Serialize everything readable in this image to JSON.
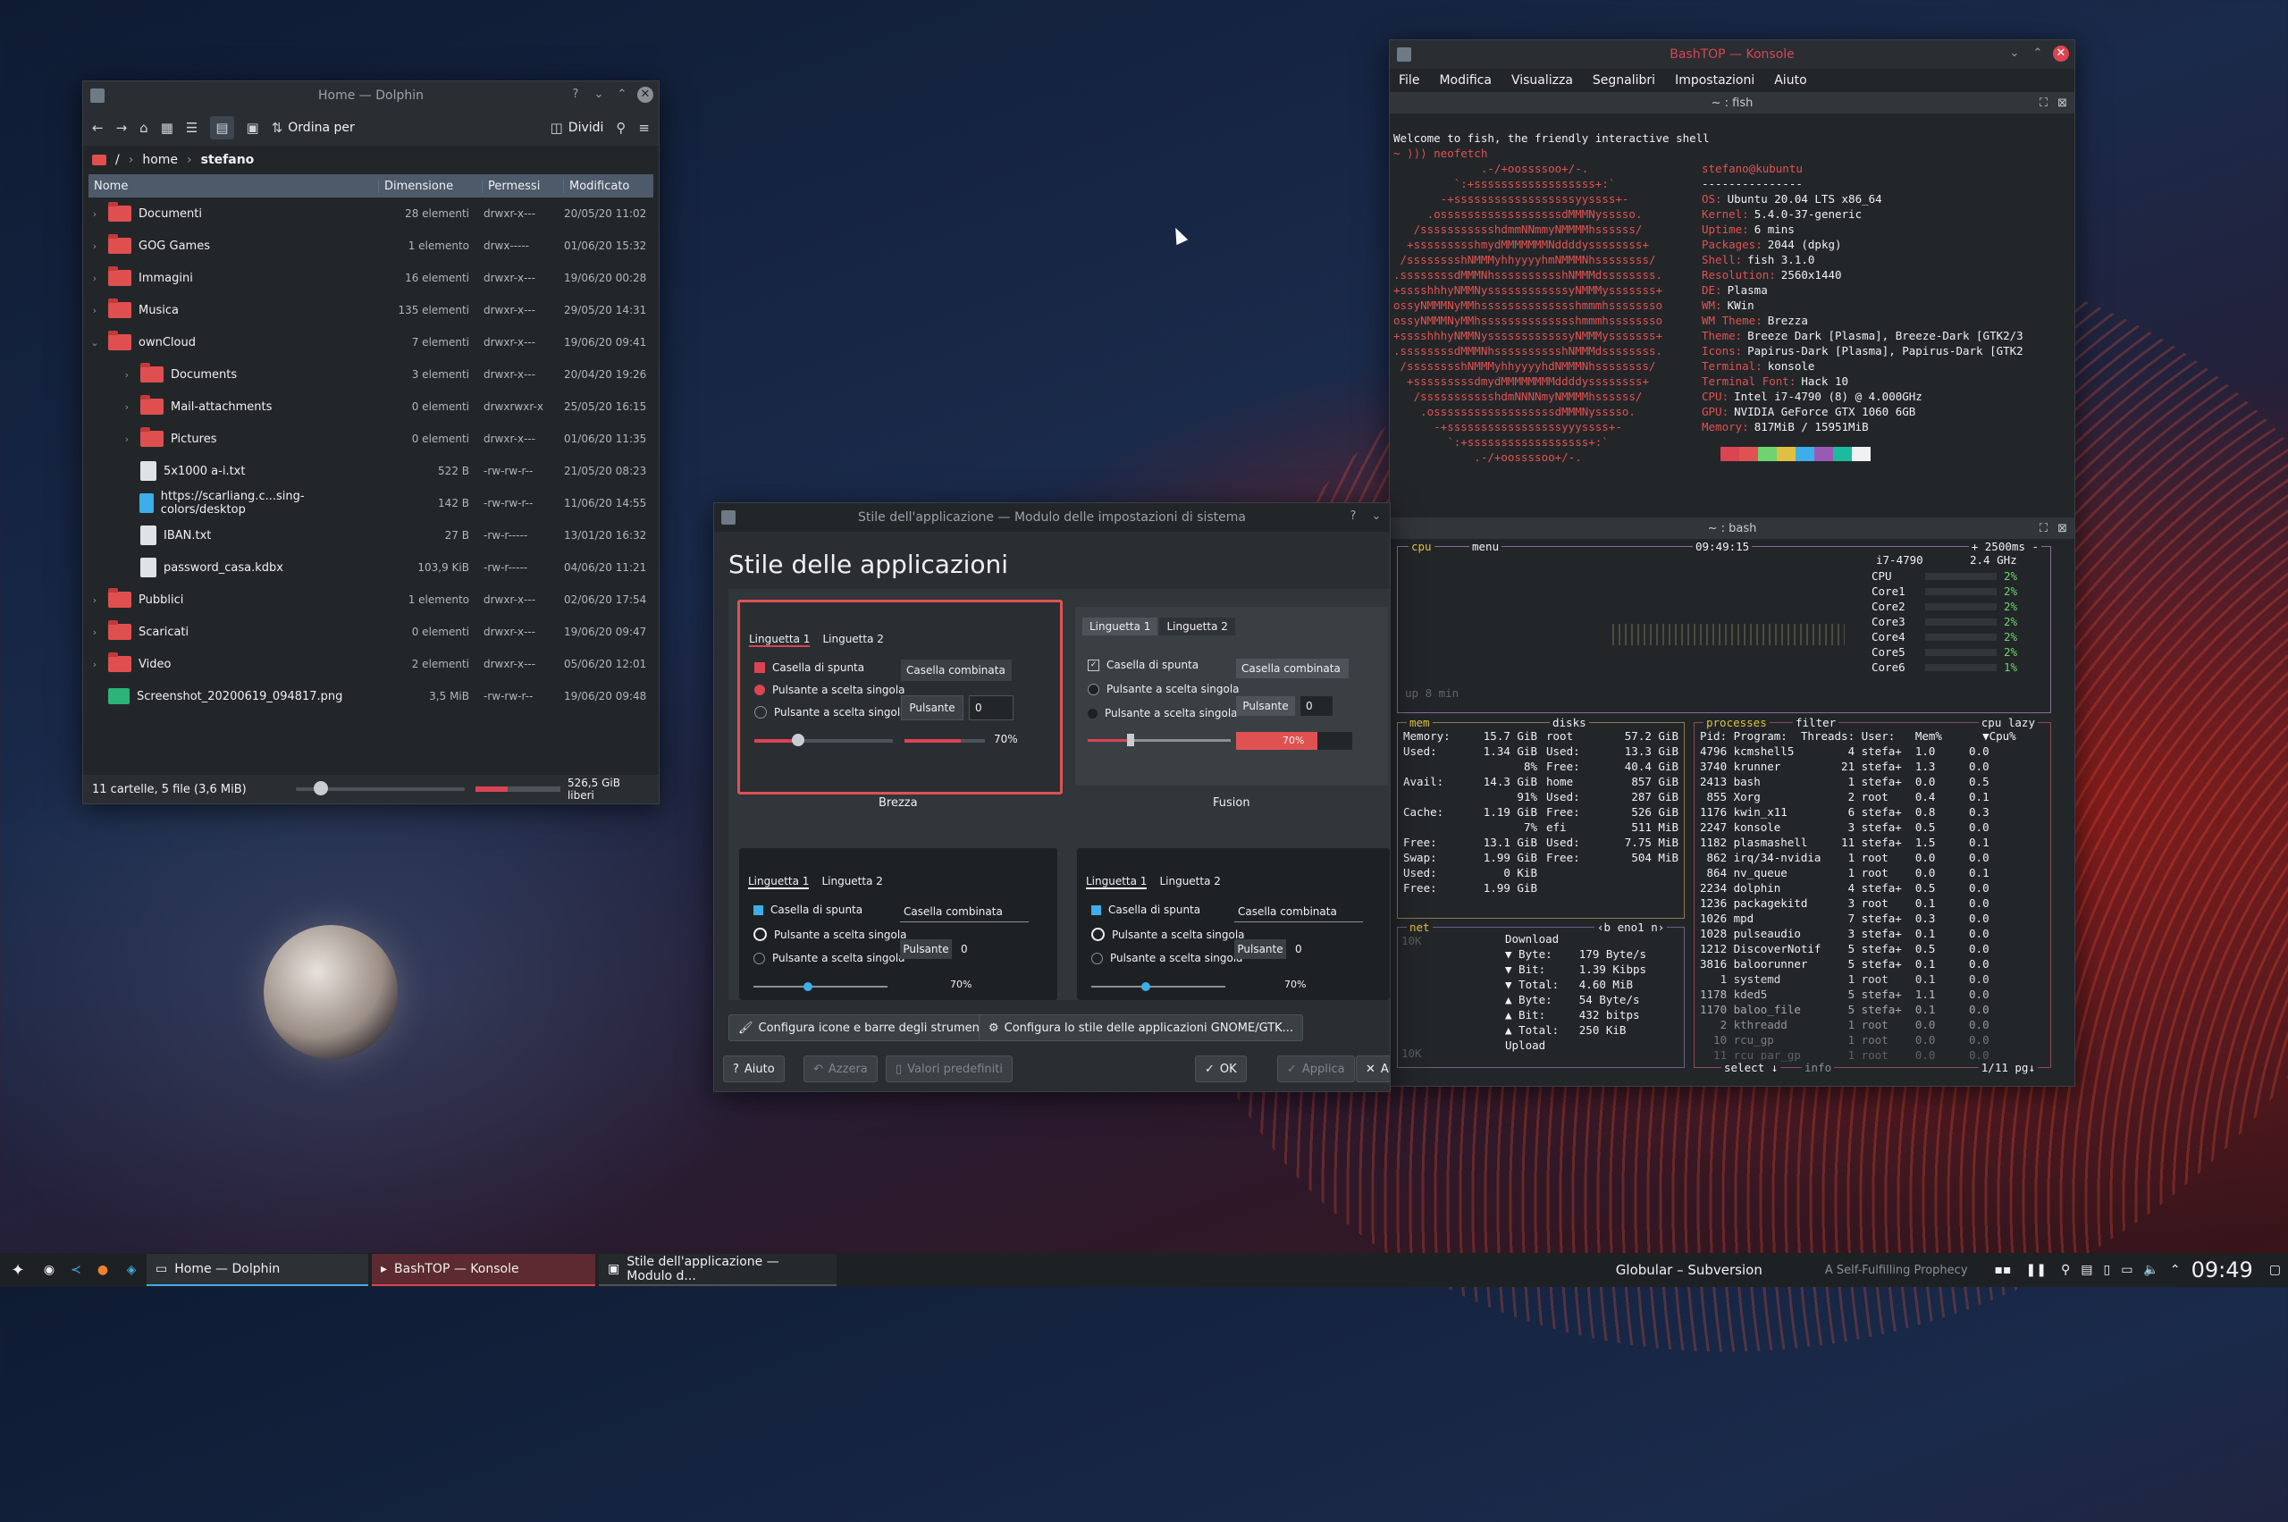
{
  "dolphin": {
    "title": "Home — Dolphin",
    "sort_label": "Ordina per",
    "split_label": "Dividi",
    "crumbs": [
      "/",
      "home",
      "stefano"
    ],
    "headers": [
      "Nome",
      "Dimensione",
      "Permessi",
      "Modificato"
    ],
    "rows": [
      {
        "name": "Documenti",
        "size": "28 elementi",
        "perm": "drwxr-x---",
        "mod": "20/05/20 11:02",
        "type": "folder",
        "indent": 0
      },
      {
        "name": "GOG Games",
        "size": "1 elemento",
        "perm": "drwx-----",
        "mod": "01/06/20 15:32",
        "type": "folder",
        "indent": 0
      },
      {
        "name": "Immagini",
        "size": "16 elementi",
        "perm": "drwxr-x---",
        "mod": "19/06/20 00:28",
        "type": "folder",
        "indent": 0
      },
      {
        "name": "Musica",
        "size": "135 elementi",
        "perm": "drwxr-x---",
        "mod": "29/05/20 14:31",
        "type": "folder",
        "indent": 0
      },
      {
        "name": "ownCloud",
        "size": "7 elementi",
        "perm": "drwxr-x---",
        "mod": "19/06/20 09:41",
        "type": "folder",
        "indent": 0
      },
      {
        "name": "Documents",
        "size": "3 elementi",
        "perm": "drwxr-x---",
        "mod": "20/04/20 19:26",
        "type": "folder",
        "indent": 1
      },
      {
        "name": "Mail-attachments",
        "size": "0 elementi",
        "perm": "drwxrwxr-x",
        "mod": "25/05/20 16:15",
        "type": "folder",
        "indent": 1
      },
      {
        "name": "Pictures",
        "size": "0 elementi",
        "perm": "drwxr-x---",
        "mod": "01/06/20 11:35",
        "type": "folder",
        "indent": 1
      },
      {
        "name": "5x1000 a-i.txt",
        "size": "522 B",
        "perm": "-rw-rw-r--",
        "mod": "21/05/20 08:23",
        "type": "file",
        "indent": 1
      },
      {
        "name": "https://scarliang.c...sing-colors/desktop",
        "size": "142 B",
        "perm": "-rw-rw-r--",
        "mod": "11/06/20 14:55",
        "type": "link",
        "indent": 1
      },
      {
        "name": "IBAN.txt",
        "size": "27 B",
        "perm": "-rw-r-----",
        "mod": "13/01/20 16:32",
        "type": "file",
        "indent": 1
      },
      {
        "name": "password_casa.kdbx",
        "size": "103,9 KiB",
        "perm": "-rw-r-----",
        "mod": "04/06/20 11:21",
        "type": "file",
        "indent": 1
      },
      {
        "name": "Pubblici",
        "size": "1 elemento",
        "perm": "drwxr-x---",
        "mod": "02/06/20 17:54",
        "type": "folder",
        "indent": 0
      },
      {
        "name": "Scaricati",
        "size": "0 elementi",
        "perm": "drwxr-x---",
        "mod": "19/06/20 09:47",
        "type": "folder",
        "indent": 0
      },
      {
        "name": "Video",
        "size": "2 elementi",
        "perm": "drwxr-x---",
        "mod": "05/06/20 12:01",
        "type": "folder",
        "indent": 0
      },
      {
        "name": "Screenshot_20200619_094817.png",
        "size": "3,5 MiB",
        "perm": "-rw-rw-r--",
        "mod": "19/06/20 09:48",
        "type": "image",
        "indent": 0
      }
    ],
    "status_left": "11 cartelle, 5 file (3,6 MiB)",
    "status_right": "526,5 GiB liberi"
  },
  "konsole": {
    "title": "BashTOP — Konsole",
    "menu": [
      "File",
      "Modifica",
      "Visualizza",
      "Segnalibri",
      "Impostazioni",
      "Aiuto"
    ],
    "tab_top": "~ : fish",
    "tab_bottom": "~ : bash",
    "welcome": "Welcome to fish, the friendly interactive shell",
    "prompt": "~ ⟩⟩⟩ neofetch",
    "prompt2": "~ ⟩⟩⟩ ▯",
    "user": "stefano@kubuntu",
    "sep": "---------------",
    "info": [
      [
        "OS:",
        "Ubuntu 20.04 LTS x86_64"
      ],
      [
        "Kernel:",
        "5.4.0-37-generic"
      ],
      [
        "Uptime:",
        "6 mins"
      ],
      [
        "Packages:",
        "2044 (dpkg)"
      ],
      [
        "Shell:",
        "fish 3.1.0"
      ],
      [
        "Resolution:",
        "2560x1440"
      ],
      [
        "DE:",
        "Plasma"
      ],
      [
        "WM:",
        "KWin"
      ],
      [
        "WM Theme:",
        "Brezza"
      ],
      [
        "Theme:",
        "Breeze Dark [Plasma], Breeze-Dark [GTK2/3"
      ],
      [
        "Icons:",
        "Papirus-Dark [Plasma], Papirus-Dark [GTK2"
      ],
      [
        "Terminal:",
        "konsole"
      ],
      [
        "Terminal Font:",
        "Hack 10"
      ],
      [
        "CPU:",
        "Intel i7-4790 (8) @ 4.000GHz"
      ],
      [
        "GPU:",
        "NVIDIA GeForce GTX 1060 6GB"
      ],
      [
        "Memory:",
        "817MiB / 15951MiB"
      ]
    ],
    "swatches": [
      "#232629",
      "#da4453",
      "#e05252",
      "#6fd36f",
      "#e0c040",
      "#3daee9",
      "#9b59b6",
      "#1abc9c",
      "#eff0f1"
    ],
    "ascii": [
      "             .-/+oossssoo+/-.",
      "         `:+ssssssssssssssssss+:`",
      "       -+ssssssssssssssssssyyssss+-",
      "     .ossssssssssssssssssdMMMNysssso.",
      "   /ssssssssssshdmmNNmmyNMMMMhssssss/",
      "  +ssssssssshmydMMMMMMMNddddyssssssss+",
      " /sssssssshNMMMyhhyyyyhmNMMMNhssssssss/",
      ".ssssssssdMMMNhsssssssssshNMMMdssssssss.",
      "+sssshhhyNMMNyssssssssssssyNMMMysssssss+",
      "ossyNMMMNyMMhsssssssssssssshmmmhssssssso",
      "ossyNMMMNyMMhsssssssssssssshmmmhssssssso",
      "+sssshhhyNMMNyssssssssssssyNMMMysssssss+",
      ".ssssssssdMMMNhsssssssssshNMMMdssssssss.",
      " /sssssssshNMMMyhhyyyyhdNMMMNhssssssss/",
      "  +sssssssssdmydMMMMMMMMddddyssssssss+",
      "   /ssssssssssshdmNNNNmyNMMMMhssssss/",
      "    .ossssssssssssssssssdMMMNysssso.",
      "      -+sssssssssssssssssyyyssss+-",
      "        `:+ssssssssssssssssss+:`",
      "            .-/+oossssoo+/-."
    ],
    "btop": {
      "cpu_label": "cpu",
      "menu_label": "menu",
      "clock": "09:49:15",
      "rate": "+ 2500ms -",
      "cpu_model": "i7-4790",
      "cpu_freq": "2.4 GHz",
      "uptime": "up 8 min",
      "cores": [
        [
          "CPU",
          "2%"
        ],
        [
          "Core1",
          "2%"
        ],
        [
          "Core2",
          "2%"
        ],
        [
          "Core3",
          "2%"
        ],
        [
          "Core4",
          "2%"
        ],
        [
          "Core5",
          "2%"
        ],
        [
          "Core6",
          "1%"
        ]
      ],
      "mem_label": "mem",
      "disks_label": "disks",
      "mem": [
        [
          "Memory:",
          "15.7 GiB"
        ],
        [
          "Used:",
          "1.34 GiB"
        ],
        [
          "",
          "8%"
        ],
        [
          "Avail:",
          "14.3 GiB"
        ],
        [
          "",
          "91%"
        ],
        [
          "Cache:",
          "1.19 GiB"
        ],
        [
          "",
          "7%"
        ],
        [
          "Free:",
          "13.1 GiB"
        ],
        [
          "Swap:",
          "1.99 GiB"
        ],
        [
          "Used:",
          "0 KiB"
        ],
        [
          "Free:",
          "1.99 GiB"
        ]
      ],
      "disks": [
        [
          "root",
          "57.2 GiB"
        ],
        [
          "Used:",
          "13.3 GiB"
        ],
        [
          "Free:",
          "40.4 GiB"
        ],
        [
          "",
          ""
        ],
        [
          "home",
          "857 GiB"
        ],
        [
          "Used:",
          "287 GiB"
        ],
        [
          "Free:",
          "526 GiB"
        ],
        [
          "",
          ""
        ],
        [
          "efi",
          "511 MiB"
        ],
        [
          "Used:",
          "7.75 MiB"
        ],
        [
          "Free:",
          "504 MiB"
        ]
      ],
      "net_label": "net",
      "net_iface": "‹b eno1 n›",
      "net": [
        "Download",
        "▼ Byte:    179 Byte/s",
        "▼ Bit:     1.39 Kibps",
        "▼ Total:   4.60 MiB",
        "▲ Byte:    54 Byte/s",
        "▲ Bit:     432 bitps",
        "▲ Total:   250 KiB",
        "Upload"
      ],
      "net_scale": [
        "10K",
        "10K"
      ],
      "proc_label": "processes",
      "filter_label": "filter",
      "sort_label": "cpu lazy",
      "proc_header": "Pid: Program:  Threads: User:   Mem%      ▼Cpu%",
      "procs": [
        "4796 kcmshell5        4 stefa+  1.0     0.0",
        "3740 krunner         21 stefa+  1.3     0.0",
        "2413 bash             1 stefa+  0.0     0.5",
        " 855 Xorg             2 root    0.4     0.1",
        "1176 kwin_x11         6 stefa+  0.8     0.3",
        "2247 konsole          3 stefa+  0.5     0.0",
        "1182 plasmashell     11 stefa+  1.5     0.1",
        " 862 irq/34-nvidia    1 root    0.0     0.0",
        " 864 nv_queue         1 root    0.0     0.1",
        "2234 dolphin          4 stefa+  0.5     0.0",
        "1236 packagekitd      3 root    0.1     0.0",
        "1026 mpd              7 stefa+  0.3     0.0",
        "1028 pulseaudio       3 stefa+  0.1     0.0",
        "1212 DiscoverNotif    5 stefa+  0.5     0.0",
        "3816 baloorunner      5 stefa+  0.1     0.0",
        "   1 systemd          1 root    0.1     0.0",
        "1178 kded5            5 stefa+  1.1     0.0",
        "1170 baloo_file       5 stefa+  0.1     0.0",
        "   2 kthreadd         1 root    0.0     0.0",
        "  10 rcu_gp           1 root    0.0     0.0",
        "  11 rcu_par_gp       1 root    0.0     0.0"
      ],
      "select": "select ↓",
      "info": "info",
      "pages": "1/11 pg↓"
    }
  },
  "settings": {
    "title": "Stile dell'applicazione — Modulo delle impostazioni di sistema",
    "heading": "Stile delle applicazioni",
    "tab1": "Linguetta 1",
    "tab2": "Linguetta 2",
    "checkbox": "Casella di spunta",
    "radio": "Pulsante a scelta singola",
    "combo": "Casella combinata",
    "button": "Pulsante",
    "spin": "0",
    "progress": "70%",
    "style1": "Brezza",
    "style2": "Fusion",
    "btn_icons": "Configura icone e barre degli strumenti",
    "btn_gtk": "Configura lo stile delle applicazioni GNOME/GTK...",
    "btn_help": "Aiuto",
    "btn_reset": "Azzera",
    "btn_defaults": "Valori predefiniti",
    "btn_ok": "OK",
    "btn_apply": "Applica",
    "btn_cancel": "An"
  },
  "taskbar": {
    "tasks": [
      "Home — Dolphin",
      "BashTOP — Konsole",
      "Stile dell'applicazione — Modulo d..."
    ],
    "song": "Globular – Subversion",
    "album": "A Self-Fulfilling Prophecy",
    "clock": "09:49"
  }
}
